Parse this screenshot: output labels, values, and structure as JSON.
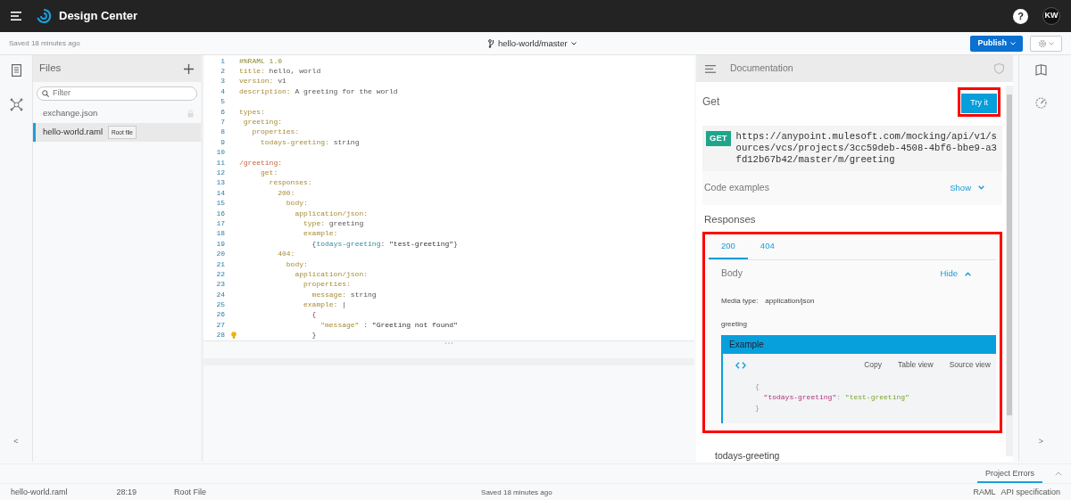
{
  "top_bar": {
    "title": "Design Center",
    "help": "?",
    "avatar": "KW"
  },
  "sub_bar": {
    "saved": "Saved 18 minutes ago",
    "branch": "hello-world/master",
    "publish": "Publish"
  },
  "files": {
    "title": "Files",
    "filter_placeholder": "Filter",
    "items": [
      {
        "name": "exchange.json",
        "selected": false,
        "locked": true
      },
      {
        "name": "hello-world.raml",
        "selected": true,
        "locked": false,
        "badge": "Root file"
      }
    ]
  },
  "editor": {
    "lines": [
      {
        "number": "1",
        "segments": [
          {
            "kind": "comment",
            "text": "#%RAML 1.0"
          }
        ]
      },
      {
        "number": "2",
        "segments": [
          {
            "kind": "key",
            "text": "title:"
          },
          {
            "kind": "plain",
            "text": " hello, world"
          }
        ]
      },
      {
        "number": "3",
        "segments": [
          {
            "kind": "key",
            "text": "version:"
          },
          {
            "kind": "plain",
            "text": " v1"
          }
        ]
      },
      {
        "number": "4",
        "segments": [
          {
            "kind": "key",
            "text": "description:"
          },
          {
            "kind": "plain",
            "text": " A greeting for the world"
          }
        ]
      },
      {
        "number": "5"
      },
      {
        "number": "6",
        "segments": [
          {
            "kind": "key",
            "text": "types:"
          }
        ]
      },
      {
        "number": "7",
        "segments": [
          {
            "kind": "key",
            "text": " greeting:"
          }
        ]
      },
      {
        "number": "8",
        "segments": [
          {
            "kind": "key",
            "text": "   properties:"
          }
        ]
      },
      {
        "number": "9",
        "segments": [
          {
            "kind": "key",
            "text": "     todays-greeting:"
          },
          {
            "kind": "plain",
            "text": " string"
          }
        ]
      },
      {
        "number": "10"
      },
      {
        "number": "11",
        "segments": [
          {
            "kind": "resource",
            "text": "/greeting:"
          }
        ]
      },
      {
        "number": "12",
        "segments": [
          {
            "kind": "key",
            "text": "     get:"
          }
        ]
      },
      {
        "number": "13",
        "segments": [
          {
            "kind": "key",
            "text": "       responses:"
          }
        ]
      },
      {
        "number": "14",
        "segments": [
          {
            "kind": "key",
            "text": "         200:"
          }
        ]
      },
      {
        "number": "15",
        "segments": [
          {
            "kind": "key",
            "text": "           body:"
          }
        ]
      },
      {
        "number": "16",
        "segments": [
          {
            "kind": "key",
            "text": "             application/json:"
          }
        ]
      },
      {
        "number": "17",
        "segments": [
          {
            "kind": "key",
            "text": "               type:"
          },
          {
            "kind": "plain",
            "text": " greeting"
          }
        ]
      },
      {
        "number": "18",
        "segments": [
          {
            "kind": "key",
            "text": "               example:"
          }
        ]
      },
      {
        "number": "19",
        "segments": [
          {
            "kind": "plain",
            "text": "                 {"
          },
          {
            "kind": "prop",
            "text": "todays-greeting"
          },
          {
            "kind": "plain",
            "text": ": "
          },
          {
            "kind": "string",
            "text": "\"test-greeting\""
          },
          {
            "kind": "plain",
            "text": "}"
          }
        ]
      },
      {
        "number": "20",
        "segments": [
          {
            "kind": "key",
            "text": "         404:"
          }
        ]
      },
      {
        "number": "21",
        "segments": [
          {
            "kind": "key",
            "text": "           body:"
          }
        ]
      },
      {
        "number": "22",
        "segments": [
          {
            "kind": "key",
            "text": "             application/json:"
          }
        ]
      },
      {
        "number": "23",
        "segments": [
          {
            "kind": "key",
            "text": "               properties:"
          }
        ]
      },
      {
        "number": "24",
        "segments": [
          {
            "kind": "key",
            "text": "                 message:"
          },
          {
            "kind": "plain",
            "text": " string"
          }
        ]
      },
      {
        "number": "25",
        "segments": [
          {
            "kind": "key",
            "text": "               example:"
          },
          {
            "kind": "plain",
            "text": " |"
          }
        ]
      },
      {
        "number": "26",
        "segments": [
          {
            "kind": "brace",
            "text": "                 {"
          }
        ]
      },
      {
        "number": "27",
        "segments": [
          {
            "kind": "key",
            "text": "                   \"message\""
          },
          {
            "kind": "plain",
            "text": " : "
          },
          {
            "kind": "string",
            "text": "\"Greeting not found\""
          }
        ]
      },
      {
        "number": "28",
        "hint": true,
        "segments": [
          {
            "kind": "plain",
            "text": "                 }"
          }
        ]
      }
    ]
  },
  "documentation": {
    "title": "Documentation",
    "method_title": "Get",
    "try_button": "Try it",
    "method": "GET",
    "url": "https://anypoint.mulesoft.com/mocking/api/v1/sources/vcs/projects/3cc59deb-4508-4bf6-bbe9-a3fd12b67b42/master/m/greeting",
    "code_examples": "Code examples",
    "show": "Show",
    "responses_title": "Responses",
    "response_tabs": [
      {
        "label": "200",
        "selected": true
      },
      {
        "label": "404",
        "selected": false
      }
    ],
    "body_title": "Body",
    "hide": "Hide",
    "media_type_label": "Media type:",
    "media_type": "application/json",
    "type_name": "greeting",
    "example": {
      "title": "Example",
      "actions": [
        "Copy",
        "Table view",
        "Source view"
      ],
      "code": [
        [
          {
            "kind": "brace",
            "text": "{"
          }
        ],
        [
          {
            "kind": "jkey",
            "text": "\"todays-greeting\""
          },
          {
            "kind": "brace",
            "text": ": "
          },
          {
            "kind": "jstr",
            "text": "\"test-greeting\""
          }
        ],
        [
          {
            "kind": "brace",
            "text": "}"
          }
        ]
      ]
    },
    "property": "todays-greeting"
  },
  "rails": {
    "collapse": "<",
    "expand": ">"
  },
  "bottom_panel": {
    "tab": "Project Errors"
  },
  "status_bar": {
    "file": "hello-world.raml",
    "position": "28:19",
    "file_type": "Root File",
    "saved": "Saved 18 minutes ago",
    "language": "RAML",
    "spec": "API specification"
  }
}
